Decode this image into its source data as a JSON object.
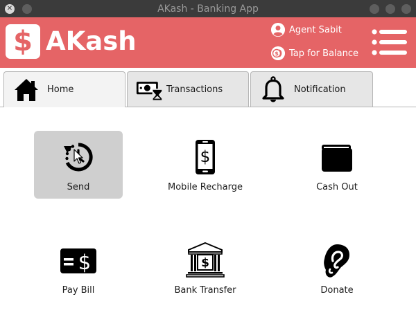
{
  "window": {
    "title": "AKash - Banking App"
  },
  "header": {
    "logo_symbol": "$",
    "brand": "AKash",
    "agent_label": "Agent Sabit",
    "balance_label": "Tap for Balance",
    "accent_color": "#e56466"
  },
  "tabs": [
    {
      "label": "Home",
      "icon": "home-icon",
      "active": true
    },
    {
      "label": "Transactions",
      "icon": "money-hourglass-icon",
      "active": false
    },
    {
      "label": "Notification",
      "icon": "bell-icon",
      "active": false
    }
  ],
  "services": [
    {
      "label": "Send",
      "icon": "history-icon"
    },
    {
      "label": "Mobile Recharge",
      "icon": "mobile-dollar-icon"
    },
    {
      "label": "Cash Out",
      "icon": "wallet-icon"
    },
    {
      "label": "Pay Bill",
      "icon": "bill-icon"
    },
    {
      "label": "Bank Transfer",
      "icon": "bank-icon"
    },
    {
      "label": "Donate",
      "icon": "donate-icon"
    }
  ]
}
